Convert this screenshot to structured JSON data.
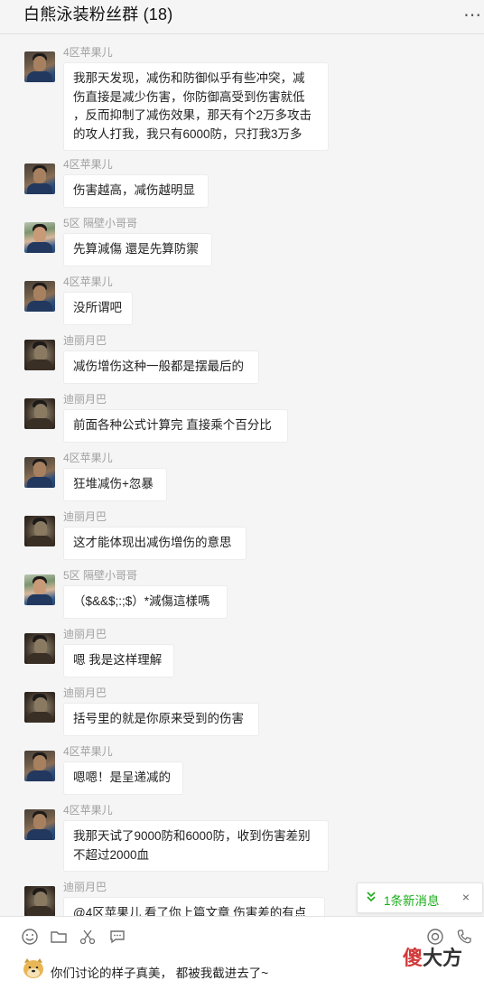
{
  "header": {
    "title": "白熊泳装粉丝群 (18)",
    "more_icon": "⋯"
  },
  "messages": [
    {
      "sender": "4区苹果儿",
      "avatar": "a1",
      "lines": [
        "我那天发现，减伤和防御似乎有些冲突，减",
        "伤直接是减少伤害，你防御高受到伤害就低",
        "，反而抑制了减伤效果，那天有个2万多攻击",
        "的攻人打我，我只有6000防，只打我3万多"
      ]
    },
    {
      "sender": "4区苹果儿",
      "avatar": "a1",
      "lines": [
        "伤害越高，减伤越明显"
      ]
    },
    {
      "sender": "5区 隔壁小哥哥",
      "avatar": "a2",
      "lines": [
        "先算減傷 還是先算防禦"
      ]
    },
    {
      "sender": "4区苹果儿",
      "avatar": "a1",
      "lines": [
        "没所谓吧"
      ]
    },
    {
      "sender": "迪丽月巴",
      "avatar": "a3",
      "lines": [
        "减伤增伤这种一般都是摆最后的"
      ]
    },
    {
      "sender": "迪丽月巴",
      "avatar": "a3",
      "lines": [
        "前面各种公式计算完 直接乘个百分比"
      ]
    },
    {
      "sender": "4区苹果儿",
      "avatar": "a1",
      "lines": [
        "狂堆减伤+忽暴"
      ]
    },
    {
      "sender": "迪丽月巴",
      "avatar": "a3",
      "lines": [
        "这才能体现出减伤增伤的意思"
      ]
    },
    {
      "sender": "5区 隔壁小哥哥",
      "avatar": "a2",
      "lines": [
        "（$&&$;:;$）*減傷這樣嗎"
      ]
    },
    {
      "sender": "迪丽月巴",
      "avatar": "a3",
      "lines": [
        "嗯 我是这样理解"
      ]
    },
    {
      "sender": "迪丽月巴",
      "avatar": "a3",
      "lines": [
        "括号里的就是你原来受到的伤害"
      ]
    },
    {
      "sender": "4区苹果儿",
      "avatar": "a1",
      "lines": [
        "嗯嗯！是呈递减的"
      ]
    },
    {
      "sender": "4区苹果儿",
      "avatar": "a1",
      "lines": [
        "我那天试了9000防和6000防，收到伤害差别",
        "不超过2000血"
      ]
    },
    {
      "sender": "迪丽月巴",
      "avatar": "a3",
      "lines": [
        "@4区苹果儿 看了你上篇文章 伤害差的有点"
      ]
    }
  ],
  "notification": {
    "chevron_icon": "chevron-double-down-icon",
    "label": "1条新消息",
    "close_label": "×"
  },
  "toolbar": {
    "icons": [
      "emoji-icon",
      "folder-icon",
      "scissors-icon",
      "chat-bubble-icon",
      "camera-icon",
      "phone-icon"
    ]
  },
  "draft": {
    "text": "你们讨论的样子真美，  都被我截进去了~"
  },
  "watermark": {
    "part1": "傻",
    "part2": "大方"
  }
}
